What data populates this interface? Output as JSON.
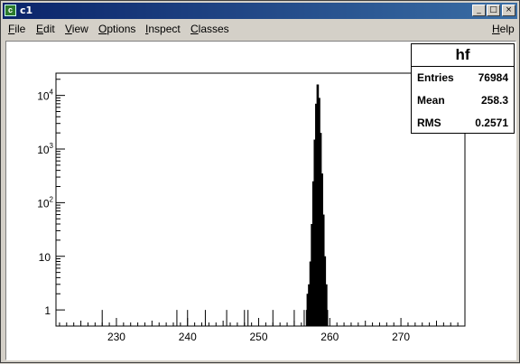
{
  "window": {
    "title": "c1",
    "icon_name": "root-canvas-icon",
    "controls": {
      "minimize": "_",
      "maximize": "□",
      "close": "×"
    }
  },
  "menu": {
    "items": [
      "File",
      "Edit",
      "View",
      "Options",
      "Inspect",
      "Classes"
    ],
    "help": "Help"
  },
  "stats": {
    "title": "hf",
    "rows": [
      {
        "label": "Entries",
        "value": "76984"
      },
      {
        "label": "Mean",
        "value": "258.3"
      },
      {
        "label": "RMS",
        "value": "0.2571"
      }
    ]
  },
  "chart_data": {
    "type": "bar",
    "title": "",
    "xlabel": "",
    "ylabel": "",
    "xlim": [
      221.5,
      279
    ],
    "ylim": [
      0.5,
      26000
    ],
    "log_y": true,
    "x_ticks": [
      "230",
      "240",
      "250",
      "260",
      "270"
    ],
    "y_ticks": [
      {
        "base": "1",
        "exp": ""
      },
      {
        "base": "10",
        "exp": ""
      },
      {
        "base": "10",
        "exp": "2"
      },
      {
        "base": "10",
        "exp": "3"
      },
      {
        "base": "10",
        "exp": "4"
      }
    ],
    "y_tick_values": [
      1,
      10,
      100,
      1000,
      10000
    ],
    "bins": [
      {
        "x": 228.0,
        "count": 1
      },
      {
        "x": 238.5,
        "count": 1
      },
      {
        "x": 240.0,
        "count": 1
      },
      {
        "x": 242.5,
        "count": 1
      },
      {
        "x": 245.5,
        "count": 1
      },
      {
        "x": 248.0,
        "count": 1
      },
      {
        "x": 248.5,
        "count": 1
      },
      {
        "x": 252.0,
        "count": 1
      },
      {
        "x": 255.0,
        "count": 1
      },
      {
        "x": 256.4,
        "count": 1
      },
      {
        "x": 256.7,
        "count": 1
      },
      {
        "x": 256.9,
        "count": 2
      },
      {
        "x": 257.1,
        "count": 3
      },
      {
        "x": 257.3,
        "count": 8
      },
      {
        "x": 257.5,
        "count": 40
      },
      {
        "x": 257.7,
        "count": 250
      },
      {
        "x": 257.9,
        "count": 1500
      },
      {
        "x": 258.1,
        "count": 7000
      },
      {
        "x": 258.3,
        "count": 16000
      },
      {
        "x": 258.5,
        "count": 9000
      },
      {
        "x": 258.7,
        "count": 2000
      },
      {
        "x": 258.9,
        "count": 350
      },
      {
        "x": 259.1,
        "count": 60
      },
      {
        "x": 259.3,
        "count": 10
      },
      {
        "x": 259.5,
        "count": 3
      },
      {
        "x": 259.7,
        "count": 1
      }
    ]
  }
}
